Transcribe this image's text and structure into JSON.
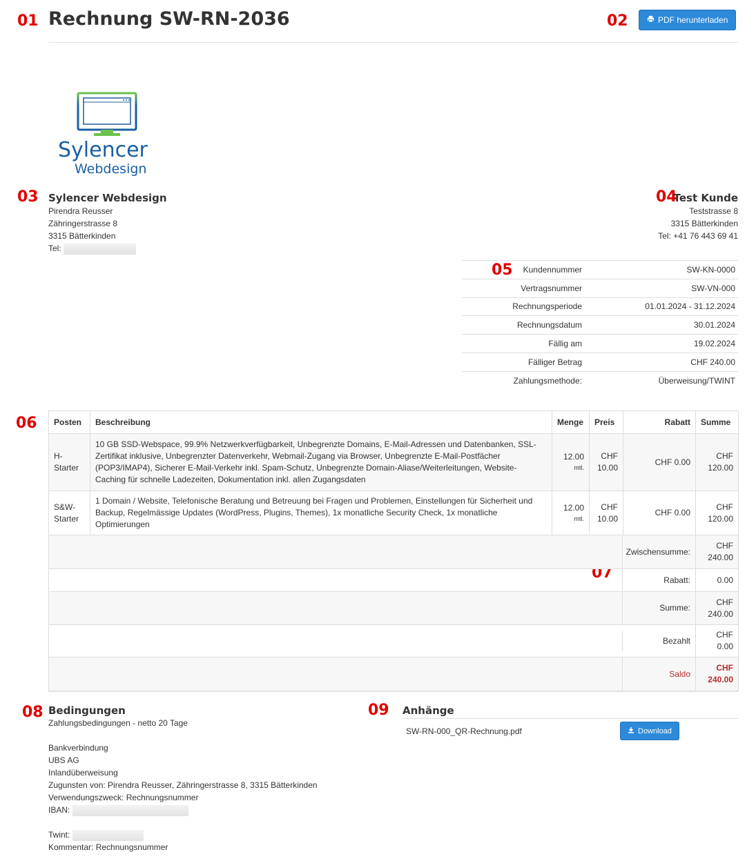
{
  "markers": [
    "01",
    "02",
    "03",
    "04",
    "05",
    "06",
    "07",
    "08",
    "09"
  ],
  "header": {
    "title": "Rechnung SW-RN-2036",
    "pdf_button": "PDF herunterladen",
    "pdf_icon": "print-icon"
  },
  "logo": {
    "line1": "Sylencer",
    "line2": "Webdesign"
  },
  "company": {
    "name": "Sylencer Webdesign",
    "contact": "Pirendra Reusser",
    "street": "Zähringerstrasse 8",
    "city": "3315 Bätterkinden",
    "tel_label": "Tel:"
  },
  "customer": {
    "name": "Test Kunde",
    "street": "Teststrasse 8",
    "city": "3315 Bätterkinden",
    "tel": "Tel: +41 76 443 69 41"
  },
  "details": [
    {
      "label": "Kundennummer",
      "value": "SW-KN-0000"
    },
    {
      "label": "Vertragsnummer",
      "value": "SW-VN-000"
    },
    {
      "label": "Rechnungsperiode",
      "value": "01.01.2024 - 31.12.2024"
    },
    {
      "label": "Rechnungsdatum",
      "value": "30.01.2024"
    },
    {
      "label": "Fällig am",
      "value": "19.02.2024"
    },
    {
      "label": "Fälliger Betrag",
      "value": "CHF 240.00"
    },
    {
      "label": "Zahlungsmethode:",
      "value": "Überweisung/TWINT"
    }
  ],
  "items_table": {
    "headers": {
      "posten": "Posten",
      "beschreibung": "Beschreibung",
      "menge": "Menge",
      "preis": "Preis",
      "rabatt": "Rabatt",
      "summe": "Summe"
    },
    "rows": [
      {
        "posten": "H-Starter",
        "beschreibung": "10 GB SSD-Webspace, 99.9% Netzwerkverfügbarkeit, Unbegrenzte Domains, E-Mail-Adressen und Datenbanken, SSL-Zertifikat inklusive, Unbegrenzter Datenverkehr, Webmail-Zugang via Browser, Unbegrenzte E-Mail-Postfächer (POP3/IMAP4), Sicherer E-Mail-Verkehr inkl. Spam-Schutz, Unbegrenzte Domain-Aliase/Weiterleitungen, Website-Caching für schnelle Ladezeiten, Dokumentation inkl. allen Zugangsdaten",
        "menge": "12.00",
        "einheit": "mtl.",
        "preis": "CHF 10.00",
        "rabatt": "CHF 0.00",
        "summe": "CHF 120.00"
      },
      {
        "posten": "S&W-Starter",
        "beschreibung": "1 Domain / Website, Telefonische Beratung und Betreuung bei Fragen und Problemen, Einstellungen für Sicherheit und Backup, Regelmässige Updates (WordPress, Plugins, Themes), 1x monatliche Security Check, 1x monatliche Optimierungen",
        "menge": "12.00",
        "einheit": "mtl.",
        "preis": "CHF 10.00",
        "rabatt": "CHF 0.00",
        "summe": "CHF 120.00"
      }
    ],
    "totals": [
      {
        "label": "Zwischensumme:",
        "value": "CHF 240.00"
      },
      {
        "label": "Rabatt:",
        "value": "0.00"
      },
      {
        "label": "Summe:",
        "value": "CHF 240.00"
      },
      {
        "label": "Bezahlt",
        "value": "CHF 0.00"
      },
      {
        "label": "Saldo",
        "value": "CHF 240.00"
      }
    ]
  },
  "terms": {
    "title": "Bedingungen",
    "payment_terms": "Zahlungsbedingungen - netto 20 Tage",
    "bank_title": "Bankverbindung",
    "bank_name": "UBS AG",
    "transfer_type": "Inlandüberweisung",
    "beneficiary": "Zugunsten von: Pirendra Reusser, Zähringerstrasse 8, 3315 Bätterkinden",
    "reference": "Verwendungszweck: Rechnungsnummer",
    "iban_label": "IBAN:",
    "twint_label": "Twint:",
    "comment": "Kommentar: Rechnungsnummer"
  },
  "attachments": {
    "title": "Anhänge",
    "files": [
      {
        "name": "SW-RN-000_QR-Rechnung.pdf",
        "button": "Download"
      }
    ]
  },
  "colors": {
    "accent": "#2d8ad9",
    "marker": "#e00000",
    "saldo": "#b52b2b",
    "logo_blue": "#1a5fa3",
    "logo_green": "#6cc24a"
  }
}
